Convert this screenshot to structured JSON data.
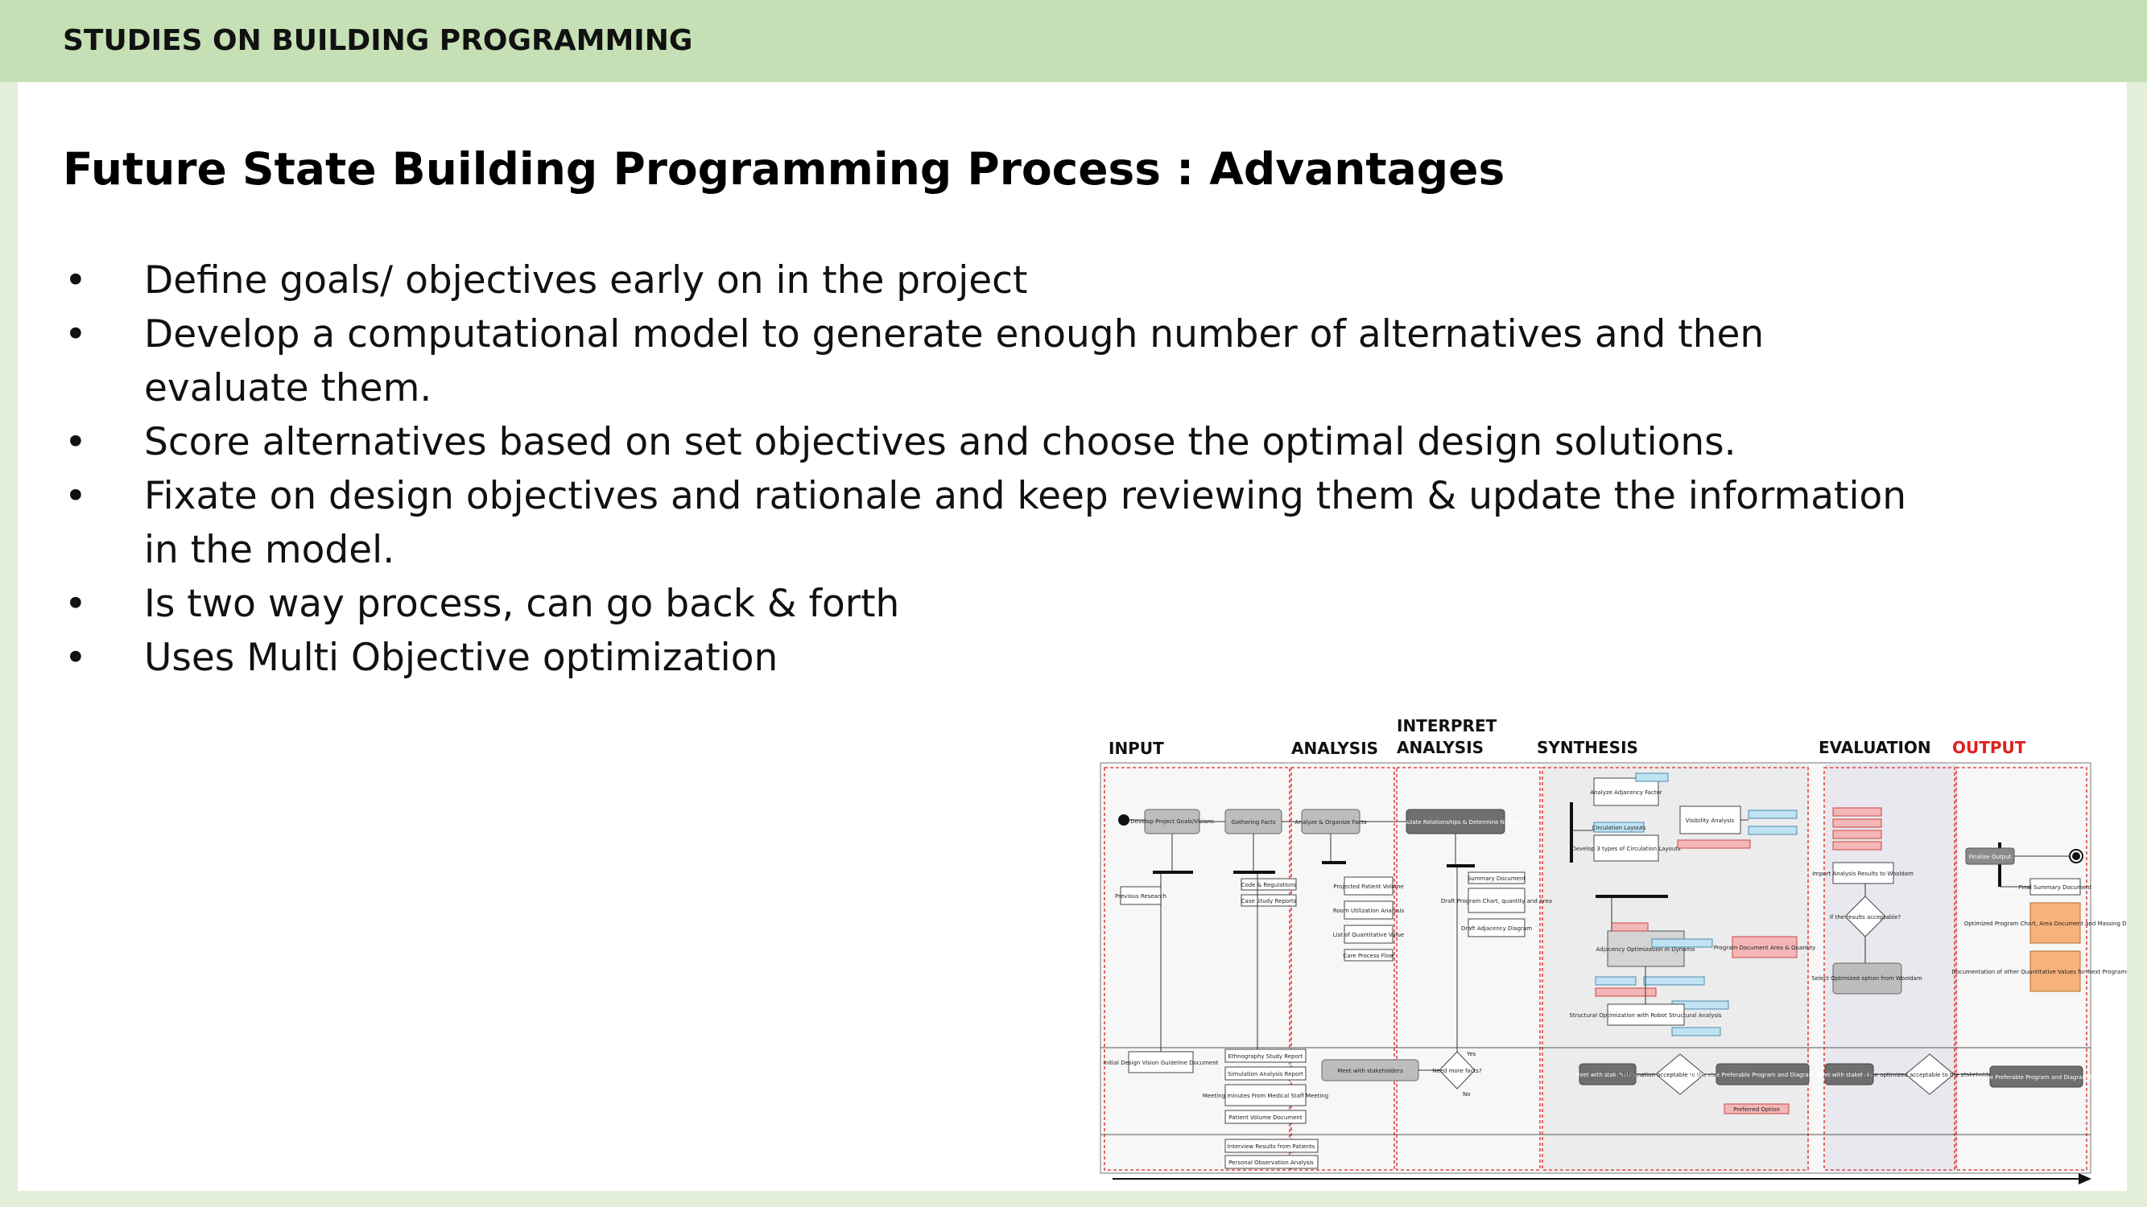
{
  "header": {
    "section_title": "STUDIES ON BUILDING PROGRAMMING"
  },
  "slide": {
    "title": "Future State Building Programming Process : Advantages",
    "bullet_symbol": "•",
    "bullets": [
      "Define goals/ objectives early on in the project",
      "Develop a computational model to generate enough number of alternatives and then evaluate them.",
      "Score alternatives based on set objectives and choose the optimal design solutions.",
      "Fixate on design objectives and rationale and keep reviewing them & update the information in the model.",
      "Is two way process, can go back & forth",
      "Uses Multi Objective optimization"
    ]
  },
  "diagram": {
    "phases": {
      "input": "INPUT",
      "analysis": "ANALYSIS",
      "interpret_1": "INTERPRET",
      "interpret_2": "ANALYSIS",
      "synthesis": "SYNTHESIS",
      "evaluation": "EVALUATION",
      "output": "OUTPUT"
    },
    "colors": {
      "output_label": "#e02020",
      "gray_box": "#bdbdbd",
      "dark_box": "#6f6f6f",
      "pink_box": "#f4b6b6",
      "blue_box": "#bfe3f2",
      "orange_box": "#f6b27a",
      "dashed_red": "#e04848"
    },
    "nodes": {
      "develop_goals": "Develop Project Goals/Visions",
      "gathering_facts": "Gathering Facts",
      "analyze_facts": "Analyze & Organize Facts",
      "formulate": "Formulate Relationships & Determine Needs",
      "previous_research": "Previous Research",
      "code_regs": "Code & Regulations",
      "case_study": "Case Study Reports",
      "projected_volume": "Projected Patient Volume",
      "room_utilization": "Room Utilization Analysis",
      "quant_value": "List of Quantitative Value",
      "care_process": "Care Process Flow",
      "summary_doc": "Summary Document",
      "draft_program": "Draft Program Chart, quantity and Area",
      "draft_adjacency": "Draft Adjacency Diagram",
      "analyze_adjacency": "Analyze Adjacency Factor",
      "visibility": "Visibility Analysis",
      "circulation": "Circulation Layouts",
      "develop_layouts": "Develop 3 types of Circulation Layouts",
      "adjacency_opt": "Adjacency Optimization in Dynamo",
      "program_doc": "Program Document Area & Quantity",
      "structural_opt": "Structural Optimization with Robot Structural Analysis",
      "import_results": "Import Analysis Results to Wooldam",
      "if_results": "If the results acceptable?",
      "select_optimized": "Select Optimized option from Wooldam",
      "finalize": "Finalize Output",
      "final_summary": "Final Summary Document",
      "optimized_chart": "Optimized Program Chart, Area Document and Massing Diagram",
      "documentation": "Documentation of other Quantitative Values for Next Programming Phase",
      "initial_vision": "Initial Design Vision Guideline Document",
      "ethnography": "Ethnography Study Report",
      "simulation": "Simulation Analysis Report",
      "meeting_minutes": "Meeting minutes From Medical Staff Meeting",
      "patient_volume": "Patient Volume Document",
      "interview": "Interview Results from Patients",
      "personal_obs": "Personal Observation Analysis",
      "meet_stakeholders": "Meet with stakeholders",
      "need_more": "Need more facts?",
      "meet_stakeholders_2": "Meet with stakeholders",
      "is_acceptable": "Is Information acceptable to the stakeholder?",
      "determine_preferable": "Determine Preferable Program and Diagram Option",
      "preferred_option": "Preferred Option",
      "meet_stakeholders_3": "Meet with stakeholders",
      "is_optimized": "Is the optimized acceptable to the stakeholder?",
      "determine_final": "Determine Preferable Program and Diagram Option",
      "yes": "Yes",
      "no": "No"
    }
  }
}
